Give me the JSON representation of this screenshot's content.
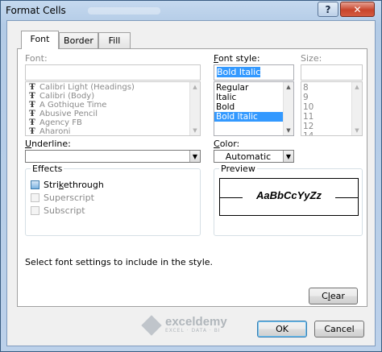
{
  "window": {
    "title": "Format Cells",
    "help_glyph": "?",
    "close_glyph": "✕"
  },
  "tabs": [
    {
      "label": "Font",
      "active": true
    },
    {
      "label": "Border",
      "active": false
    },
    {
      "label": "Fill",
      "active": false
    }
  ],
  "font": {
    "label": "Font:",
    "value": "",
    "items": [
      "Calibri Light (Headings)",
      "Calibri (Body)",
      "A Gothique Time",
      "Abusive Pencil",
      "Agency FB",
      "Aharoni"
    ],
    "icon": "truetype-icon"
  },
  "font_style": {
    "label": "Font style:",
    "value": "Bold Italic",
    "items": [
      "Regular",
      "Italic",
      "Bold",
      "Bold Italic"
    ],
    "selected": "Bold Italic"
  },
  "size": {
    "label": "Size:",
    "value": "",
    "items": [
      "8",
      "9",
      "10",
      "11",
      "12",
      "14"
    ]
  },
  "underline": {
    "label": "Underline:",
    "value": ""
  },
  "color": {
    "label": "Color:",
    "value": "Automatic"
  },
  "effects": {
    "title": "Effects",
    "strikethrough": "Strikethrough",
    "superscript": "Superscript",
    "subscript": "Subscript"
  },
  "preview": {
    "title": "Preview",
    "sample": "AaBbCcYyZz"
  },
  "info_text": "Select font settings to include in the style.",
  "buttons": {
    "clear": "Clear",
    "ok": "OK",
    "cancel": "Cancel"
  },
  "watermark": {
    "name": "exceldemy",
    "tagline": "EXCEL · DATA · BI"
  },
  "colors": {
    "selection": "#3399ff",
    "title_bar": "#b3cbe6",
    "close_button": "#c8452c"
  }
}
